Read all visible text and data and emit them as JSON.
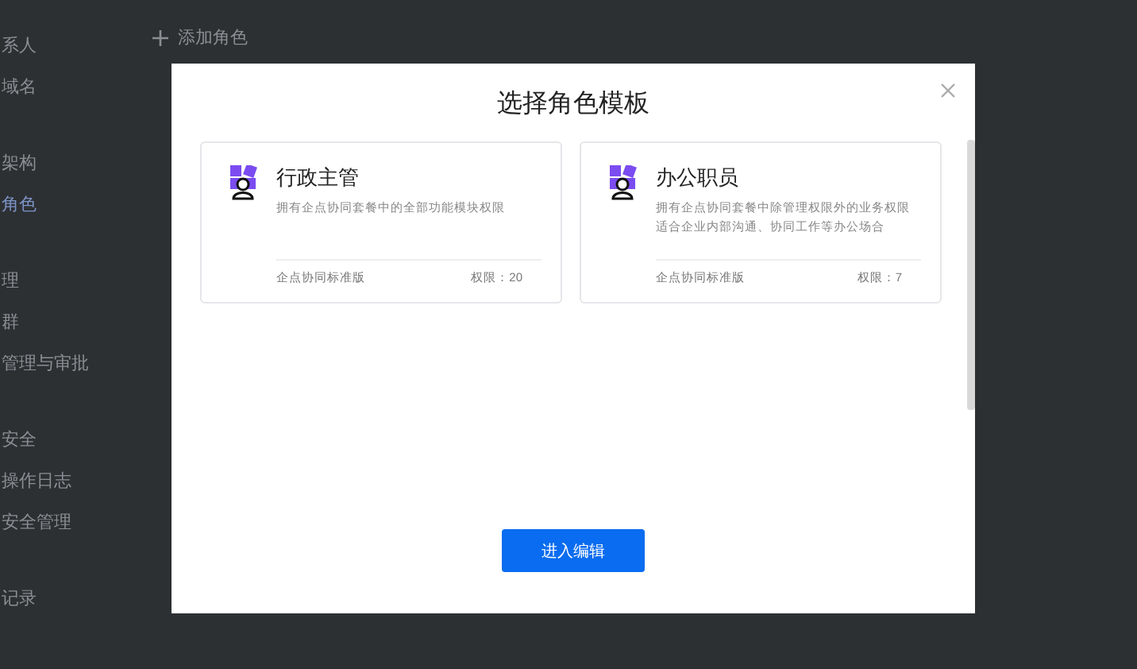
{
  "sidebar": {
    "groups": [
      {
        "items": [
          {
            "label": "系人",
            "selected": false
          },
          {
            "label": "域名",
            "selected": false
          }
        ]
      },
      {
        "items": [
          {
            "label": "架构",
            "selected": false
          },
          {
            "label": "角色",
            "selected": true
          }
        ]
      },
      {
        "items": [
          {
            "label": "理",
            "selected": false
          },
          {
            "label": "群",
            "selected": false
          },
          {
            "label": "管理与审批",
            "selected": false
          }
        ]
      },
      {
        "items": [
          {
            "label": "安全",
            "selected": false
          },
          {
            "label": "操作日志",
            "selected": false
          },
          {
            "label": "安全管理",
            "selected": false
          }
        ]
      },
      {
        "items": [
          {
            "label": "记录",
            "selected": false
          }
        ]
      }
    ]
  },
  "toolbar": {
    "add_button": "添加角色"
  },
  "dialog": {
    "title": "选择角色模板",
    "cards": [
      {
        "name": "行政主管",
        "description": "拥有企点协同套餐中的全部功能模块权限",
        "edition": "企点协同标准版",
        "permissions": "权限：20"
      },
      {
        "name": "办公职员",
        "description": "拥有企点协同套餐中除管理权限外的业务权限适合企业内部沟通、协同工作等办公场合",
        "edition": "企点协同标准版",
        "permissions": "权限：7"
      }
    ],
    "primary_button": "进入编辑"
  }
}
